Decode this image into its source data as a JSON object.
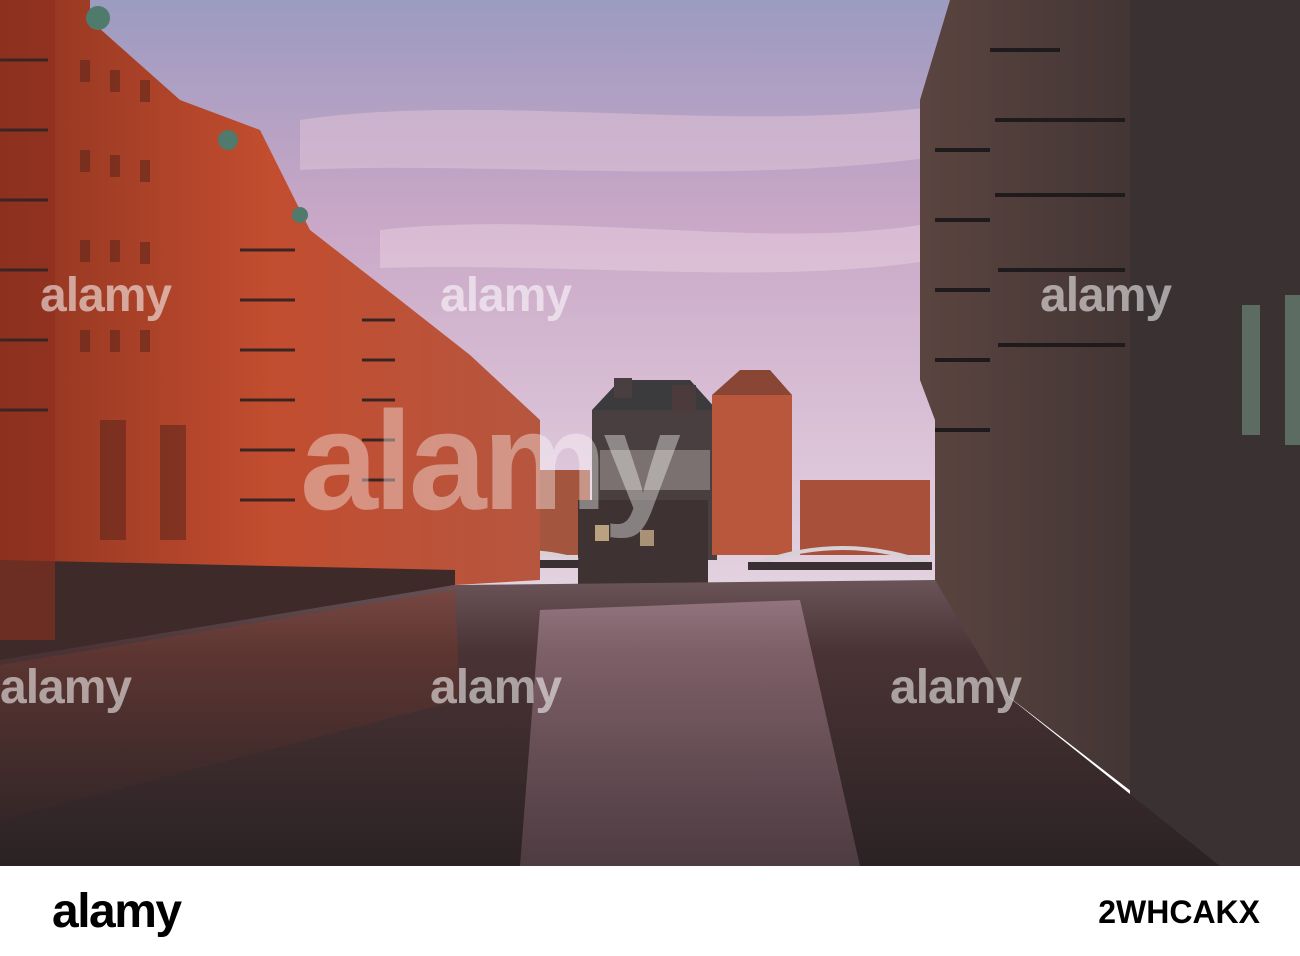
{
  "photo": {
    "scene": "canal-warehouses-dusk",
    "colors": {
      "sky_top": "#9e9cc0",
      "sky_mid": "#cfa9c7",
      "sky_low": "#dcc4d8",
      "brick_left": "#b8452c",
      "brick_right": "#3c3433",
      "water": "#3f2a2c"
    }
  },
  "watermark": {
    "text": "alamy"
  },
  "footer": {
    "logo": "alamy",
    "image_id": "2WHCAKX"
  }
}
